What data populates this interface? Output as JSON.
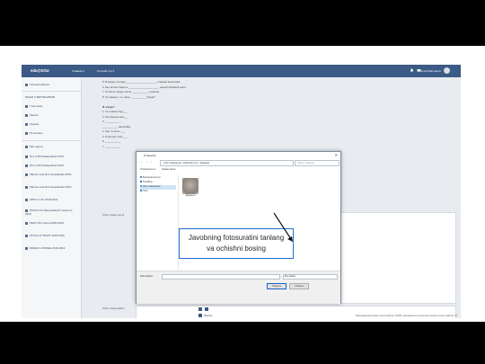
{
  "app": {
    "logo": "edu@SOU",
    "menu": [
      "Главная ▾",
      "Русский (ru) ▾"
    ],
    "user": "Ismoil Rahmanov"
  },
  "sidebar": {
    "items": [
      "Личный кабинет",
      "РЕЖИ С ВЕТРЕНИКОВ",
      "Участники",
      "Значки",
      "Оценки",
      "Пополнить"
    ],
    "courses_header": "Мои курсы",
    "courses": [
      "Ф-К-Ч-80 Ламерейкой 2019",
      "Ф-К-Ч-80 Ламерейкой 2019",
      "Матем-тика Ф-К Нашайкова 2019",
      "Матем-тика Ф-К Нашайкова 2019",
      "ОБУЧ-С ЛЧ 2018-2019",
      "ПРАКТ-ИЧ Ламерейкой 2 семестр 2019",
      "РЕСУ-ЛЬ Специ 2018-2019",
      "РУССК-О ПРАКТ 2018-2019",
      "ЯЗЫКИ и БОЛЕЕ 2018-2019"
    ]
  },
  "page": {
    "lines": [
      "5. В корень сегодня ______________________ главный выпускник.",
      "6. Мы читали повесть _____________________ , нашей любимой книги.",
      "7. По было обиды летом ____________ (опасно).",
      "8. Ты знаешь, что такое ___________ бурда?",
      "",
      "III. Когда?",
      "1. Ты плакать буд___",
      "2. Мы раньше мен___",
      "3. ___________",
      "   ___________ настройки.",
      "4. Хар ты было ___",
      "5. Я смотрю тебе ___",
      "6. ___________",
      "7. ___________"
    ],
    "answer_label": "Ответ в виде текста",
    "file_label": "Ответ в виде файла",
    "files_label": "Файлы",
    "right_note": "Максимальный размер новых файлов: 100Мб, максимальное количество прикрепленных файлов: 20"
  },
  "dialog": {
    "title": "Открытие",
    "close": "✕",
    "address": "› Этот компьютер › Рабочий стол › Задание",
    "search_placeholder": "Поиск: Задание",
    "toolbar": [
      "Упорядочить ▾",
      "Новая папка"
    ],
    "tree": [
      "Быстрый доступ",
      "OneDrive",
      "Этот компьютер",
      "Сеть"
    ],
    "selected_tree_index": 2,
    "file_name": "Задание 2",
    "file_name_label": "Имя файла:",
    "file_type": "Все файлы",
    "open_button": "Открыть",
    "cancel_button": "Отмена"
  },
  "callout": {
    "line1": "Javobning fotosuratini tanlang",
    "line2": "va ochishni bosing",
    "border_color": "#1f6fd1"
  },
  "colors": {
    "brand": "#3b5a85",
    "frame": "#000000"
  }
}
